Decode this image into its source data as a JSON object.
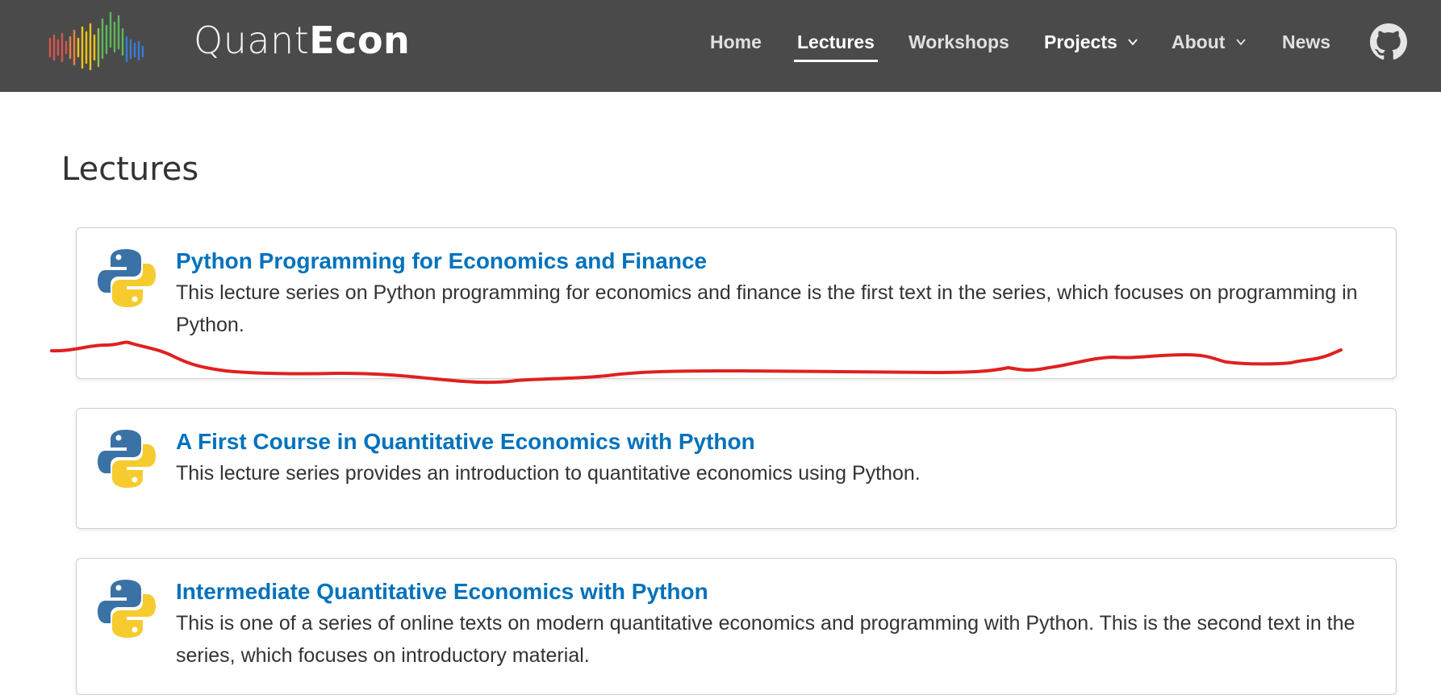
{
  "brand": {
    "name_light": "Quant",
    "name_bold": "Econ"
  },
  "nav": {
    "items": [
      {
        "label": "Home"
      },
      {
        "label": "Lectures",
        "active": true
      },
      {
        "label": "Workshops"
      },
      {
        "label": "Projects",
        "dropdown": true
      },
      {
        "label": "About",
        "dropdown": true
      },
      {
        "label": "News"
      }
    ],
    "github_icon": "github-icon"
  },
  "page": {
    "title": "Lectures"
  },
  "lectures": [
    {
      "title": "Python Programming for Economics and Finance",
      "description": "This lecture series on Python programming for economics and finance is the first text in the series, which focuses on programming in Python."
    },
    {
      "title": "A First Course in Quantitative Economics with Python",
      "description": "This lecture series provides an introduction to quantitative economics using Python."
    },
    {
      "title": "Intermediate Quantitative Economics with Python",
      "description": "This is one of a series of online texts on modern quantitative economics and programming with Python. This is the second text in the series, which focuses on introductory material."
    }
  ],
  "colors": {
    "header_bg": "#4a4a4a",
    "link": "#0072bc",
    "annotation": "#e02020"
  }
}
